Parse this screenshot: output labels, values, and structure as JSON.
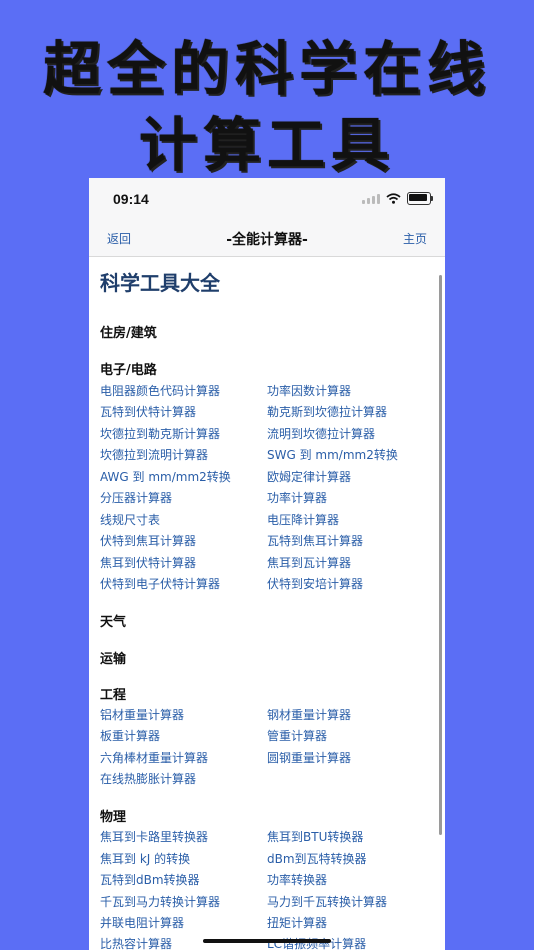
{
  "promo": {
    "line1": "超全的科学在线",
    "line2": "计算工具"
  },
  "status": {
    "time": "09:14"
  },
  "nav": {
    "back": "返回",
    "title": "-全能计算器-",
    "home": "主页"
  },
  "page_title": "科学工具大全",
  "sections": [
    {
      "title": "住房/建筑",
      "items": []
    },
    {
      "title": "电子/电路",
      "items": [
        "电阻器颜色代码计算器",
        "功率因数计算器",
        "瓦特到伏特计算器",
        "勒克斯到坎德拉计算器",
        "坎德拉到勒克斯计算器",
        "流明到坎德拉计算器",
        "坎德拉到流明计算器",
        "SWG 到 mm/mm2转换",
        "AWG 到 mm/mm2转换",
        "欧姆定律计算器",
        "分压器计算器",
        "功率计算器",
        "线规尺寸表",
        "电压降计算器",
        "伏特到焦耳计算器",
        "瓦特到焦耳计算器",
        "焦耳到伏特计算器",
        "焦耳到瓦计算器",
        "伏特到电子伏特计算器",
        "伏特到安培计算器"
      ]
    },
    {
      "title": "天气",
      "items": []
    },
    {
      "title": "运输",
      "items": []
    },
    {
      "title": "工程",
      "items": [
        "铝材重量计算器",
        "钢材重量计算器",
        "板重计算器",
        "管重计算器",
        "六角棒材重量计算器",
        "圆钢重量计算器",
        "在线热膨胀计算器"
      ]
    },
    {
      "title": "物理",
      "items": [
        "焦耳到卡路里转换器",
        "焦耳到BTU转换器",
        "焦耳到 kJ 的转换",
        "dBm到瓦特转换器",
        "瓦特到dBm转换器",
        "功率转换器",
        "千瓦到马力转换计算器",
        "马力到千瓦转换计算器",
        "并联电阻计算器",
        "扭矩计算器",
        "比热容计算器",
        "LC谐振频率计算器"
      ]
    }
  ]
}
